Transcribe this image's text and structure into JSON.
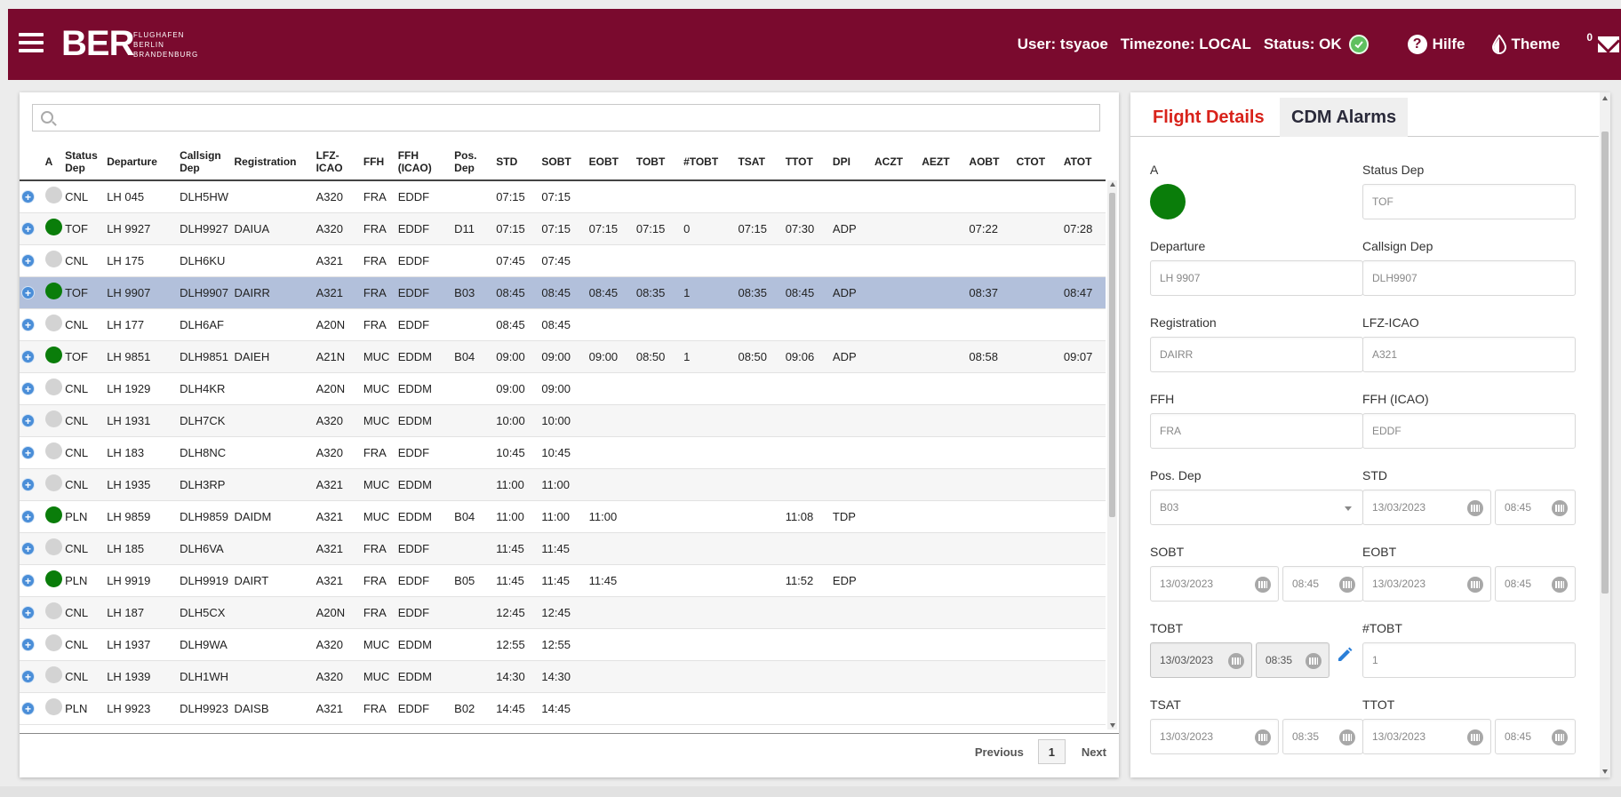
{
  "header": {
    "logo_main": "BER",
    "logo_sub_1": "FLUGHAFEN",
    "logo_sub_2": "BERLIN",
    "logo_sub_3": "BRANDENBURG",
    "user": "User: tsyaoe",
    "timezone": "Timezone: LOCAL",
    "status": "Status: OK",
    "help_label": "Hilfe",
    "theme_label": "Theme",
    "mail_count": "0",
    "brand_color": "#7a0a2e"
  },
  "search": {
    "placeholder": ""
  },
  "table": {
    "columns": [
      {
        "line1": "",
        "line2": ""
      },
      {
        "line1": "A",
        "line2": ""
      },
      {
        "line1": "Status",
        "line2": "Dep"
      },
      {
        "line1": "Departure",
        "line2": ""
      },
      {
        "line1": "Callsign",
        "line2": "Dep"
      },
      {
        "line1": "Registration",
        "line2": ""
      },
      {
        "line1": "LFZ-",
        "line2": "ICAO"
      },
      {
        "line1": "FFH",
        "line2": ""
      },
      {
        "line1": "FFH",
        "line2": "(ICAO)"
      },
      {
        "line1": "Pos.",
        "line2": "Dep"
      },
      {
        "line1": "STD",
        "line2": ""
      },
      {
        "line1": "SOBT",
        "line2": ""
      },
      {
        "line1": "EOBT",
        "line2": ""
      },
      {
        "line1": "TOBT",
        "line2": ""
      },
      {
        "line1": "#TOBT",
        "line2": ""
      },
      {
        "line1": "TSAT",
        "line2": ""
      },
      {
        "line1": "TTOT",
        "line2": ""
      },
      {
        "line1": "DPI",
        "line2": ""
      },
      {
        "line1": "ACZT",
        "line2": ""
      },
      {
        "line1": "AEZT",
        "line2": ""
      },
      {
        "line1": "AOBT",
        "line2": ""
      },
      {
        "line1": "CTOT",
        "line2": ""
      },
      {
        "line1": "ATOT",
        "line2": ""
      }
    ],
    "rows": [
      {
        "a": "grey",
        "status": "CNL",
        "departure": "LH 045",
        "callsign": "DLH5HW",
        "registration": "",
        "lfz": "A320",
        "ffh": "FRA",
        "ffh_icao": "EDDF",
        "pos": "",
        "std": "07:15",
        "sobt": "07:15",
        "eobt": "",
        "tobt": "",
        "ntobt": "",
        "tsat": "",
        "ttot": "",
        "dpi": "",
        "aczt": "",
        "aezt": "",
        "aobt": "",
        "ctot": "",
        "atot": ""
      },
      {
        "a": "green",
        "status": "TOF",
        "departure": "LH 9927",
        "callsign": "DLH9927",
        "registration": "DAIUA",
        "lfz": "A320",
        "ffh": "FRA",
        "ffh_icao": "EDDF",
        "pos": "D11",
        "std": "07:15",
        "sobt": "07:15",
        "eobt": "07:15",
        "tobt": "07:15",
        "ntobt": "0",
        "tsat": "07:15",
        "ttot": "07:30",
        "dpi": "ADP",
        "aczt": "",
        "aezt": "",
        "aobt": "07:22",
        "ctot": "",
        "atot": "07:28"
      },
      {
        "a": "grey",
        "status": "CNL",
        "departure": "LH 175",
        "callsign": "DLH6KU",
        "registration": "",
        "lfz": "A321",
        "ffh": "FRA",
        "ffh_icao": "EDDF",
        "pos": "",
        "std": "07:45",
        "sobt": "07:45",
        "eobt": "",
        "tobt": "",
        "ntobt": "",
        "tsat": "",
        "ttot": "",
        "dpi": "",
        "aczt": "",
        "aezt": "",
        "aobt": "",
        "ctot": "",
        "atot": ""
      },
      {
        "a": "green",
        "status": "TOF",
        "departure": "LH 9907",
        "callsign": "DLH9907",
        "registration": "DAIRR",
        "lfz": "A321",
        "ffh": "FRA",
        "ffh_icao": "EDDF",
        "pos": "B03",
        "std": "08:45",
        "sobt": "08:45",
        "eobt": "08:45",
        "tobt": "08:35",
        "ntobt": "1",
        "tsat": "08:35",
        "ttot": "08:45",
        "dpi": "ADP",
        "aczt": "",
        "aezt": "",
        "aobt": "08:37",
        "ctot": "",
        "atot": "08:47",
        "selected": true
      },
      {
        "a": "grey",
        "status": "CNL",
        "departure": "LH 177",
        "callsign": "DLH6AF",
        "registration": "",
        "lfz": "A20N",
        "ffh": "FRA",
        "ffh_icao": "EDDF",
        "pos": "",
        "std": "08:45",
        "sobt": "08:45",
        "eobt": "",
        "tobt": "",
        "ntobt": "",
        "tsat": "",
        "ttot": "",
        "dpi": "",
        "aczt": "",
        "aezt": "",
        "aobt": "",
        "ctot": "",
        "atot": ""
      },
      {
        "a": "green",
        "status": "TOF",
        "departure": "LH 9851",
        "callsign": "DLH9851",
        "registration": "DAIEH",
        "lfz": "A21N",
        "ffh": "MUC",
        "ffh_icao": "EDDM",
        "pos": "B04",
        "std": "09:00",
        "sobt": "09:00",
        "eobt": "09:00",
        "tobt": "08:50",
        "ntobt": "1",
        "tsat": "08:50",
        "ttot": "09:06",
        "dpi": "ADP",
        "aczt": "",
        "aezt": "",
        "aobt": "08:58",
        "ctot": "",
        "atot": "09:07"
      },
      {
        "a": "grey",
        "status": "CNL",
        "departure": "LH 1929",
        "callsign": "DLH4KR",
        "registration": "",
        "lfz": "A20N",
        "ffh": "MUC",
        "ffh_icao": "EDDM",
        "pos": "",
        "std": "09:00",
        "sobt": "09:00",
        "eobt": "",
        "tobt": "",
        "ntobt": "",
        "tsat": "",
        "ttot": "",
        "dpi": "",
        "aczt": "",
        "aezt": "",
        "aobt": "",
        "ctot": "",
        "atot": ""
      },
      {
        "a": "grey",
        "status": "CNL",
        "departure": "LH 1931",
        "callsign": "DLH7CK",
        "registration": "",
        "lfz": "A320",
        "ffh": "MUC",
        "ffh_icao": "EDDM",
        "pos": "",
        "std": "10:00",
        "sobt": "10:00",
        "eobt": "",
        "tobt": "",
        "ntobt": "",
        "tsat": "",
        "ttot": "",
        "dpi": "",
        "aczt": "",
        "aezt": "",
        "aobt": "",
        "ctot": "",
        "atot": ""
      },
      {
        "a": "grey",
        "status": "CNL",
        "departure": "LH 183",
        "callsign": "DLH8NC",
        "registration": "",
        "lfz": "A320",
        "ffh": "FRA",
        "ffh_icao": "EDDF",
        "pos": "",
        "std": "10:45",
        "sobt": "10:45",
        "eobt": "",
        "tobt": "",
        "ntobt": "",
        "tsat": "",
        "ttot": "",
        "dpi": "",
        "aczt": "",
        "aezt": "",
        "aobt": "",
        "ctot": "",
        "atot": ""
      },
      {
        "a": "grey",
        "status": "CNL",
        "departure": "LH 1935",
        "callsign": "DLH3RP",
        "registration": "",
        "lfz": "A321",
        "ffh": "MUC",
        "ffh_icao": "EDDM",
        "pos": "",
        "std": "11:00",
        "sobt": "11:00",
        "eobt": "",
        "tobt": "",
        "ntobt": "",
        "tsat": "",
        "ttot": "",
        "dpi": "",
        "aczt": "",
        "aezt": "",
        "aobt": "",
        "ctot": "",
        "atot": ""
      },
      {
        "a": "green",
        "status": "PLN",
        "departure": "LH 9859",
        "callsign": "DLH9859",
        "registration": "DAIDM",
        "lfz": "A321",
        "ffh": "MUC",
        "ffh_icao": "EDDM",
        "pos": "B04",
        "std": "11:00",
        "sobt": "11:00",
        "eobt": "11:00",
        "tobt": "",
        "ntobt": "",
        "tsat": "",
        "ttot": "11:08",
        "dpi": "TDP",
        "aczt": "",
        "aezt": "",
        "aobt": "",
        "ctot": "",
        "atot": ""
      },
      {
        "a": "grey",
        "status": "CNL",
        "departure": "LH 185",
        "callsign": "DLH6VA",
        "registration": "",
        "lfz": "A321",
        "ffh": "FRA",
        "ffh_icao": "EDDF",
        "pos": "",
        "std": "11:45",
        "sobt": "11:45",
        "eobt": "",
        "tobt": "",
        "ntobt": "",
        "tsat": "",
        "ttot": "",
        "dpi": "",
        "aczt": "",
        "aezt": "",
        "aobt": "",
        "ctot": "",
        "atot": ""
      },
      {
        "a": "green",
        "status": "PLN",
        "departure": "LH 9919",
        "callsign": "DLH9919",
        "registration": "DAIRT",
        "lfz": "A321",
        "ffh": "FRA",
        "ffh_icao": "EDDF",
        "pos": "B05",
        "std": "11:45",
        "sobt": "11:45",
        "eobt": "11:45",
        "tobt": "",
        "ntobt": "",
        "tsat": "",
        "ttot": "11:52",
        "dpi": "EDP",
        "aczt": "",
        "aezt": "",
        "aobt": "",
        "ctot": "",
        "atot": ""
      },
      {
        "a": "grey",
        "status": "CNL",
        "departure": "LH 187",
        "callsign": "DLH5CX",
        "registration": "",
        "lfz": "A20N",
        "ffh": "FRA",
        "ffh_icao": "EDDF",
        "pos": "",
        "std": "12:45",
        "sobt": "12:45",
        "eobt": "",
        "tobt": "",
        "ntobt": "",
        "tsat": "",
        "ttot": "",
        "dpi": "",
        "aczt": "",
        "aezt": "",
        "aobt": "",
        "ctot": "",
        "atot": ""
      },
      {
        "a": "grey",
        "status": "CNL",
        "departure": "LH 1937",
        "callsign": "DLH9WA",
        "registration": "",
        "lfz": "A320",
        "ffh": "MUC",
        "ffh_icao": "EDDM",
        "pos": "",
        "std": "12:55",
        "sobt": "12:55",
        "eobt": "",
        "tobt": "",
        "ntobt": "",
        "tsat": "",
        "ttot": "",
        "dpi": "",
        "aczt": "",
        "aezt": "",
        "aobt": "",
        "ctot": "",
        "atot": ""
      },
      {
        "a": "grey",
        "status": "CNL",
        "departure": "LH 1939",
        "callsign": "DLH1WH",
        "registration": "",
        "lfz": "A320",
        "ffh": "MUC",
        "ffh_icao": "EDDM",
        "pos": "",
        "std": "14:30",
        "sobt": "14:30",
        "eobt": "",
        "tobt": "",
        "ntobt": "",
        "tsat": "",
        "ttot": "",
        "dpi": "",
        "aczt": "",
        "aezt": "",
        "aobt": "",
        "ctot": "",
        "atot": ""
      },
      {
        "a": "grey",
        "status": "PLN",
        "departure": "LH 9923",
        "callsign": "DLH9923",
        "registration": "DAISB",
        "lfz": "A321",
        "ffh": "FRA",
        "ffh_icao": "EDDF",
        "pos": "B02",
        "std": "14:45",
        "sobt": "14:45",
        "eobt": "",
        "tobt": "",
        "ntobt": "",
        "tsat": "",
        "ttot": "",
        "dpi": "",
        "aczt": "",
        "aezt": "",
        "aobt": "",
        "ctot": "",
        "atot": ""
      }
    ],
    "status_colors": {
      "green": "#0a7d0a",
      "grey": "#d3d3d3"
    }
  },
  "pager": {
    "previous": "Previous",
    "page": "1",
    "next": "Next"
  },
  "details": {
    "tab_flight_details": "Flight Details",
    "tab_cdm_alarms": "CDM Alarms",
    "labels": {
      "a": "A",
      "status_dep": "Status Dep",
      "departure": "Departure",
      "callsign_dep": "Callsign Dep",
      "registration": "Registration",
      "lfz_icao": "LFZ-ICAO",
      "ffh": "FFH",
      "ffh_icao": "FFH (ICAO)",
      "pos_dep": "Pos. Dep",
      "std": "STD",
      "sobt": "SOBT",
      "eobt": "EOBT",
      "tobt": "TOBT",
      "ntobt": "#TOBT",
      "tsat": "TSAT",
      "ttot": "TTOT"
    },
    "values": {
      "status_dep": "TOF",
      "departure": "LH 9907",
      "callsign_dep": "DLH9907",
      "registration": "DAIRR",
      "lfz_icao": "A321",
      "ffh": "FRA",
      "ffh_icao": "EDDF",
      "pos_dep": "B03",
      "std_date": "13/03/2023",
      "std_time": "08:45",
      "sobt_date": "13/03/2023",
      "sobt_time": "08:45",
      "eobt_date": "13/03/2023",
      "eobt_time": "08:45",
      "tobt_date": "13/03/2023",
      "tobt_time": "08:35",
      "ntobt": "1",
      "tsat_date": "13/03/2023",
      "tsat_time": "08:35",
      "ttot_date": "13/03/2023",
      "ttot_time": "08:45"
    }
  }
}
